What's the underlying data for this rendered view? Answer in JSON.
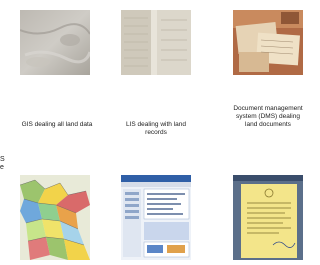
{
  "captions": {
    "gis": "GIS dealing all land data",
    "lis": "LIS dealing with land records",
    "dms": "Document management system (DMS) dealing land documents"
  },
  "left_edge_fragment": {
    "line1": "S",
    "line2": "e"
  },
  "images": [
    {
      "name": "gis-texture-photo"
    },
    {
      "name": "lis-paper-records-photo"
    },
    {
      "name": "dms-document-bundle-photo"
    },
    {
      "name": "gis-map-screenshot"
    },
    {
      "name": "lis-software-screenshot"
    },
    {
      "name": "dms-scanned-document"
    }
  ]
}
